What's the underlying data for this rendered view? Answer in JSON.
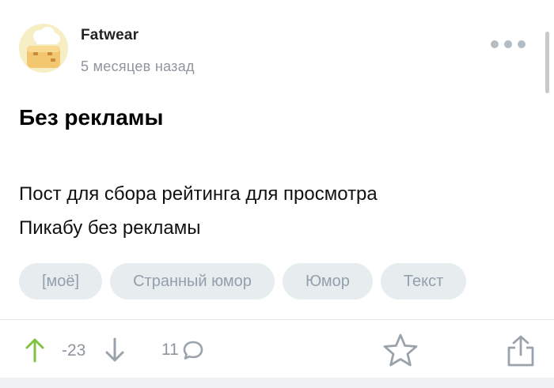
{
  "post": {
    "author": "Fatwear",
    "time_ago": "5 месяцев назад",
    "title": "Без рекламы",
    "body_lines": [
      "Пост для сбора рейтинга для просмотра",
      "Пикабу без рекламы"
    ],
    "tags": [
      "[моё]",
      "Странный юмор",
      "Юмор",
      "Текст"
    ]
  },
  "footer": {
    "rating": "-23",
    "comments_count": "11"
  },
  "icons": {
    "more": "more-dots-icon",
    "upvote": "arrow-up-icon",
    "downvote": "arrow-down-icon",
    "comments": "comment-bubble-icon",
    "save": "star-icon",
    "share": "share-icon"
  },
  "colors": {
    "upvote": "#7fc244",
    "muted": "#8e959c",
    "tag_bg": "#e7ecef",
    "tag_text": "#93a0ab"
  }
}
